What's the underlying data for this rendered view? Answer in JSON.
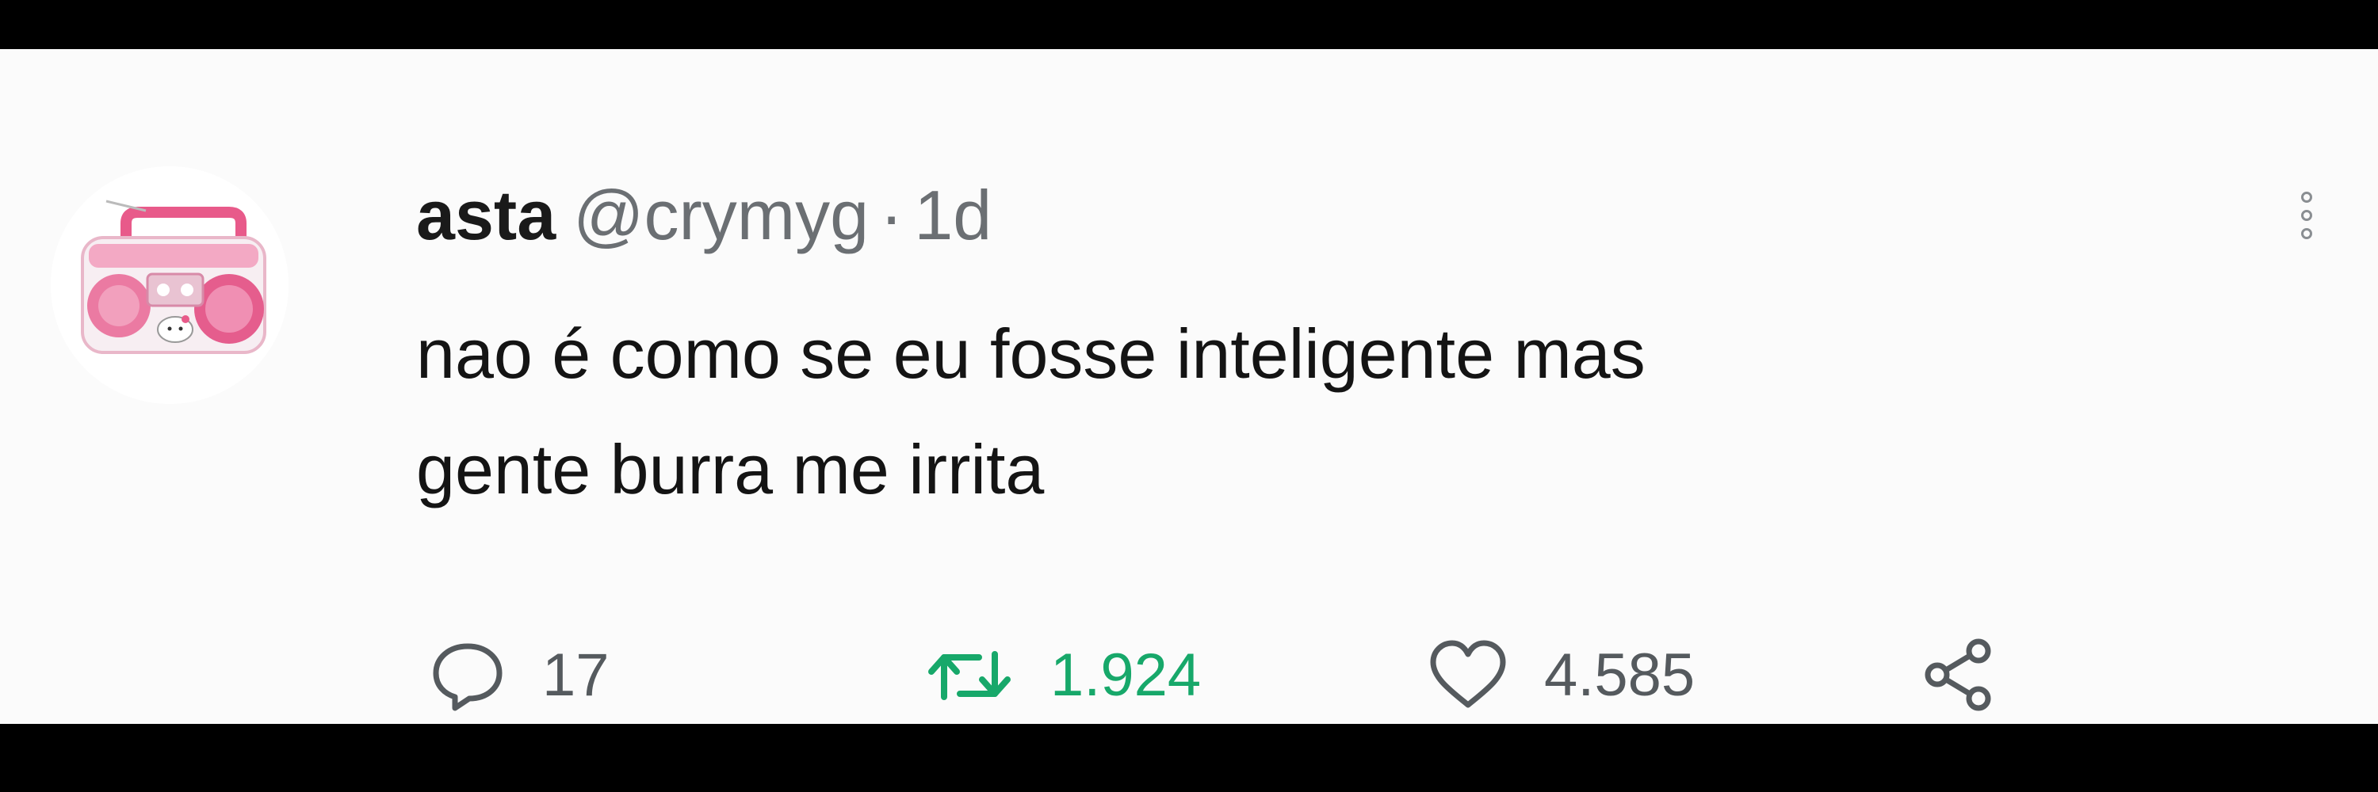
{
  "tweet": {
    "author_name": "asta",
    "author_handle": "@crymyg",
    "separator": "·",
    "timestamp": "1d",
    "text_lines": [
      "nao é como se eu fosse inteligente mas",
      "gente burra me irrita"
    ],
    "avatar_icon": "pink-boombox-avatar",
    "more_icon": "vertical-dots-icon",
    "actions": {
      "reply": {
        "icon": "reply-bubble-icon",
        "count": "17"
      },
      "retweet": {
        "icon": "retweet-icon",
        "count": "1.924",
        "color": "#17a86a"
      },
      "like": {
        "icon": "heart-icon",
        "count": "4.585"
      },
      "share": {
        "icon": "share-icon"
      }
    }
  },
  "colors": {
    "background": "#000000",
    "card": "#fbfbfb",
    "text_primary": "#141414",
    "text_secondary": "#6b6f73",
    "retweet_active": "#17a86a"
  }
}
